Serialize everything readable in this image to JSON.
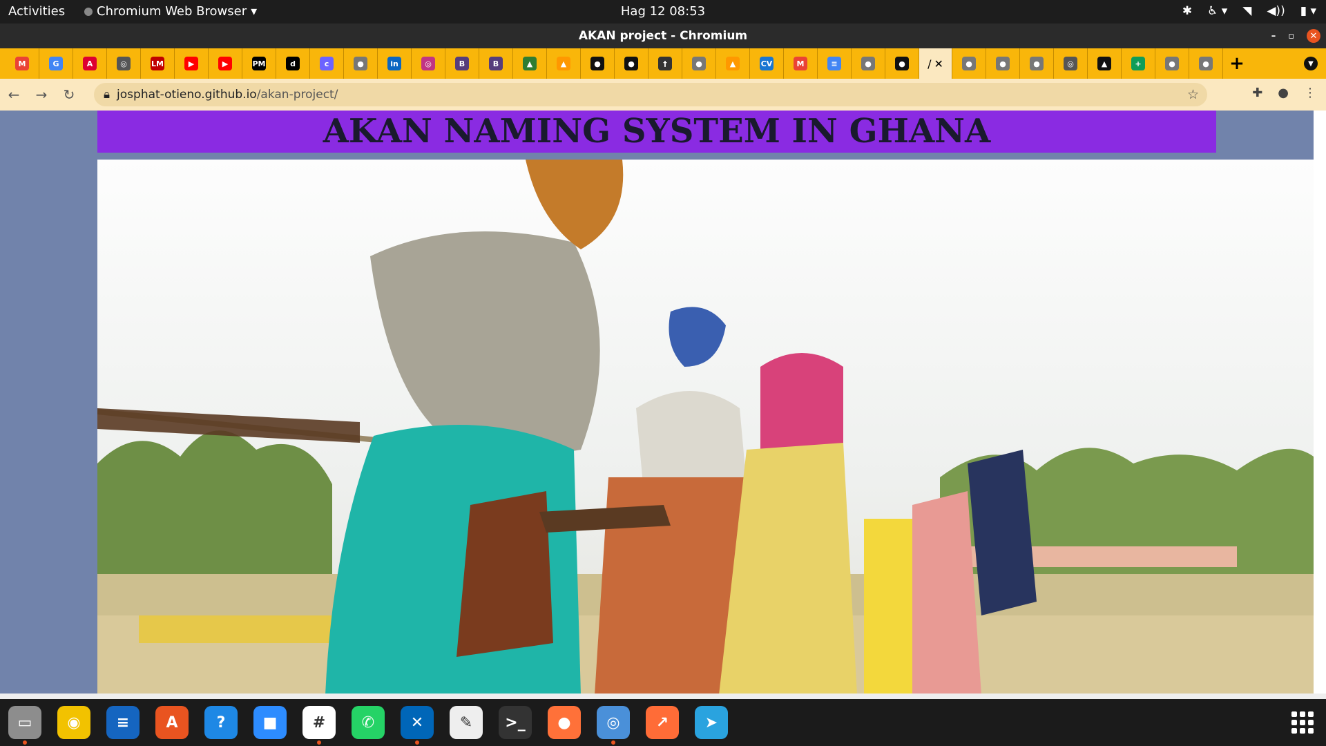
{
  "system": {
    "activities": "Activities",
    "app_menu": "Chromium Web Browser",
    "clock": "Hag 12  08:53"
  },
  "window": {
    "title": "AKAN project - Chromium"
  },
  "tabs": [
    {
      "icon": "gmail-icon",
      "color": "#ea4335",
      "glyph": "M"
    },
    {
      "icon": "google-icon",
      "color": "#4285f4",
      "glyph": "G"
    },
    {
      "icon": "angular-icon",
      "color": "#dd0031",
      "glyph": "A"
    },
    {
      "icon": "chrome-icon",
      "color": "#555555",
      "glyph": "◎"
    },
    {
      "icon": "lm-icon",
      "color": "#c00000",
      "glyph": "LM"
    },
    {
      "icon": "youtube-icon",
      "color": "#ff0000",
      "glyph": "▶"
    },
    {
      "icon": "youtube-icon",
      "color": "#ff0000",
      "glyph": "▶"
    },
    {
      "icon": "pm-icon",
      "color": "#000000",
      "glyph": "PM"
    },
    {
      "icon": "d-icon",
      "color": "#000000",
      "glyph": "d"
    },
    {
      "icon": "colorlib-icon",
      "color": "#6c63ff",
      "glyph": "c"
    },
    {
      "icon": "globe-icon",
      "color": "#777777",
      "glyph": "●"
    },
    {
      "icon": "linkedin-icon",
      "color": "#0a66c2",
      "glyph": "in"
    },
    {
      "icon": "instagram-icon",
      "color": "#c13584",
      "glyph": "◎"
    },
    {
      "icon": "bootstrap-icon",
      "color": "#563d7c",
      "glyph": "B"
    },
    {
      "icon": "bootstrap-icon",
      "color": "#563d7c",
      "glyph": "B"
    },
    {
      "icon": "chart-icon",
      "color": "#2e7d32",
      "glyph": "▲"
    },
    {
      "icon": "flame-icon",
      "color": "#ff9800",
      "glyph": "▲"
    },
    {
      "icon": "github-icon",
      "color": "#111111",
      "glyph": "●"
    },
    {
      "icon": "github-icon",
      "color": "#111111",
      "glyph": "●"
    },
    {
      "icon": "caduceus-icon",
      "color": "#333333",
      "glyph": "†"
    },
    {
      "icon": "globe-icon",
      "color": "#777777",
      "glyph": "●"
    },
    {
      "icon": "flame-icon",
      "color": "#ff9800",
      "glyph": "▲"
    },
    {
      "icon": "cv-icon",
      "color": "#1976d2",
      "glyph": "CV"
    },
    {
      "icon": "gmail-icon",
      "color": "#ea4335",
      "glyph": "M"
    },
    {
      "icon": "docs-icon",
      "color": "#4285f4",
      "glyph": "≡"
    },
    {
      "icon": "globe-icon",
      "color": "#777777",
      "glyph": "●"
    },
    {
      "icon": "github-icon",
      "color": "#111111",
      "glyph": "●"
    }
  ],
  "active_tab": {
    "glyph": "/",
    "close": "✕"
  },
  "tabs_after": [
    {
      "icon": "globe-icon",
      "color": "#777777",
      "glyph": "●"
    },
    {
      "icon": "globe-icon",
      "color": "#777777",
      "glyph": "●"
    },
    {
      "icon": "globe-icon",
      "color": "#777777",
      "glyph": "●"
    },
    {
      "icon": "chrome-icon",
      "color": "#555555",
      "glyph": "◎"
    },
    {
      "icon": "graduation-cap-icon",
      "color": "#111111",
      "glyph": "▲"
    },
    {
      "icon": "sheets-icon",
      "color": "#0f9d58",
      "glyph": "+"
    },
    {
      "icon": "globe-icon",
      "color": "#777777",
      "glyph": "●"
    },
    {
      "icon": "globe-icon",
      "color": "#777777",
      "glyph": "●"
    }
  ],
  "new_tab": "+",
  "address": {
    "host": "josphat-otieno.github.io",
    "path": "/akan-project/"
  },
  "page": {
    "heading": "AKAN NAMING SYSTEM IN GHANA"
  },
  "dock": [
    {
      "icon": "files-icon",
      "color": "#8d8d8d",
      "glyph": "▭",
      "running": true
    },
    {
      "icon": "rhythmbox-icon",
      "color": "#f2c200",
      "glyph": "◉",
      "running": false
    },
    {
      "icon": "writer-icon",
      "color": "#1565c0",
      "glyph": "≡",
      "running": false
    },
    {
      "icon": "software-center-icon",
      "color": "#e95420",
      "glyph": "A",
      "running": false
    },
    {
      "icon": "help-icon",
      "color": "#1e88e5",
      "glyph": "?",
      "running": false
    },
    {
      "icon": "zoom-icon",
      "color": "#2d8cff",
      "glyph": "■",
      "running": false
    },
    {
      "icon": "slack-icon",
      "color": "#ffffff",
      "glyph": "#",
      "running": true
    },
    {
      "icon": "whatsapp-icon",
      "color": "#25d366",
      "glyph": "✆",
      "running": false
    },
    {
      "icon": "vscode-icon",
      "color": "#0066b8",
      "glyph": "✕",
      "running": true
    },
    {
      "icon": "text-editor-icon",
      "color": "#eeeeee",
      "glyph": "✎",
      "running": false
    },
    {
      "icon": "terminal-icon",
      "color": "#333333",
      "glyph": ">_",
      "running": false
    },
    {
      "icon": "firefox-icon",
      "color": "#ff7139",
      "glyph": "●",
      "running": false
    },
    {
      "icon": "chromium-icon",
      "color": "#4a90d9",
      "glyph": "◎",
      "running": true
    },
    {
      "icon": "postman-icon",
      "color": "#ff6c37",
      "glyph": "↗",
      "running": false
    },
    {
      "icon": "telegram-icon",
      "color": "#2aa3df",
      "glyph": "➤",
      "running": false
    }
  ]
}
